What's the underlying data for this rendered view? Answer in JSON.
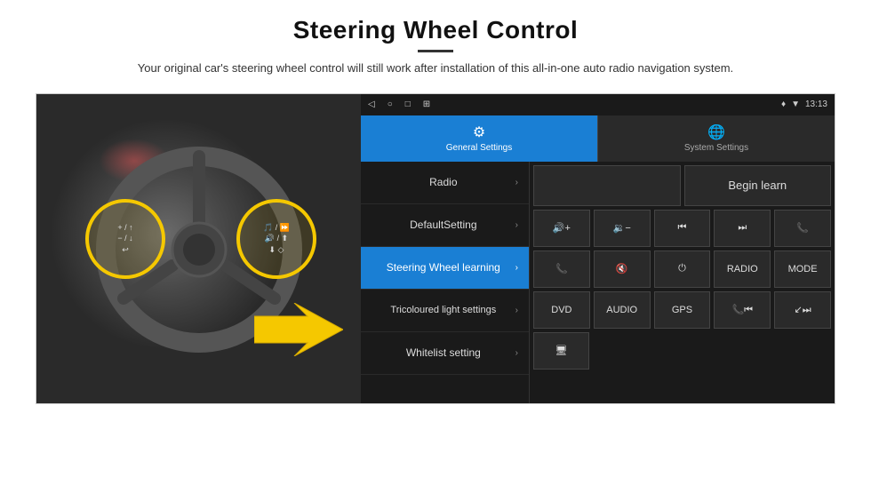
{
  "header": {
    "title": "Steering Wheel Control",
    "subtitle": "Your original car's steering wheel control will still work after installation of this all-in-one auto radio navigation system."
  },
  "status_bar": {
    "nav_icons": [
      "◁",
      "○",
      "□",
      "⊞"
    ],
    "right_icons": "♦ ▼ 13:13"
  },
  "tabs": [
    {
      "id": "general",
      "label": "General Settings",
      "active": true
    },
    {
      "id": "system",
      "label": "System Settings",
      "active": false
    }
  ],
  "menu_items": [
    {
      "id": "radio",
      "label": "Radio",
      "active": false
    },
    {
      "id": "default",
      "label": "DefaultSetting",
      "active": false
    },
    {
      "id": "steering",
      "label": "Steering Wheel learning",
      "active": true
    },
    {
      "id": "tricoloured",
      "label": "Tricoloured light settings",
      "active": false
    },
    {
      "id": "whitelist",
      "label": "Whitelist setting",
      "active": false
    }
  ],
  "control_panel": {
    "begin_learn_label": "Begin learn",
    "rows": [
      [
        {
          "id": "vol_up",
          "label": "🔊+",
          "icon": true
        },
        {
          "id": "vol_down",
          "label": "🔉-",
          "icon": true
        },
        {
          "id": "prev_track",
          "label": "⏮",
          "icon": true
        },
        {
          "id": "next_track",
          "label": "⏭",
          "icon": true
        },
        {
          "id": "phone",
          "label": "📞",
          "icon": true
        }
      ],
      [
        {
          "id": "call_answer",
          "label": "📞",
          "icon": true
        },
        {
          "id": "mute",
          "label": "🔇",
          "icon": true
        },
        {
          "id": "power",
          "label": "⏻",
          "icon": true
        },
        {
          "id": "radio_btn",
          "label": "RADIO",
          "icon": false
        },
        {
          "id": "mode_btn",
          "label": "MODE",
          "icon": false
        }
      ],
      [
        {
          "id": "dvd_btn",
          "label": "DVD",
          "icon": false
        },
        {
          "id": "audio_btn",
          "label": "AUDIO",
          "icon": false
        },
        {
          "id": "gps_btn",
          "label": "GPS",
          "icon": false
        },
        {
          "id": "phone2",
          "label": "📞⏮",
          "icon": true
        },
        {
          "id": "rewind",
          "label": "↙⏭",
          "icon": true
        }
      ],
      [
        {
          "id": "extra",
          "label": "🖥",
          "icon": true
        }
      ]
    ]
  }
}
